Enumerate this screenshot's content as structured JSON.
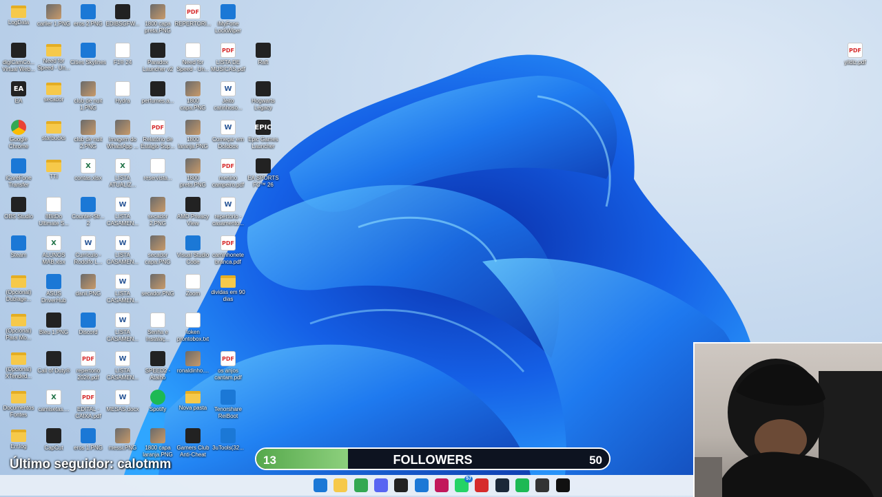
{
  "desktop": {
    "icons": [
      {
        "label": "LogData",
        "type": "folder",
        "glyph": ""
      },
      {
        "label": "carlier 1.PNG",
        "type": "img",
        "glyph": ""
      },
      {
        "label": "eros 2.PNG",
        "type": "blue",
        "glyph": ""
      },
      {
        "label": "EDIBSGFW...",
        "type": "app",
        "glyph": ""
      },
      {
        "label": "1800 capa preta.PNG",
        "type": "img",
        "glyph": ""
      },
      {
        "label": "REPERTORI...",
        "type": "pdf",
        "glyph": "PDF"
      },
      {
        "label": "iMyFone LockWiper",
        "type": "blue",
        "glyph": ""
      },
      {
        "label": "digiCamCo... Virtual Web...",
        "type": "app",
        "glyph": ""
      },
      {
        "label": "Need for Speed - Un...",
        "type": "folder",
        "glyph": ""
      },
      {
        "label": "Cities Skylines",
        "type": "blue",
        "glyph": ""
      },
      {
        "label": "F1® 24",
        "type": "txt",
        "glyph": ""
      },
      {
        "label": "Paradox Launcher v2",
        "type": "app",
        "glyph": ""
      },
      {
        "label": "Need for Speed - Un...",
        "type": "txt",
        "glyph": ""
      },
      {
        "label": "LISTA DE MUSICAS.pdf",
        "type": "pdf",
        "glyph": "PDF"
      },
      {
        "label": "Raft",
        "type": "app",
        "glyph": ""
      },
      {
        "label": "EA",
        "type": "app",
        "glyph": "EA"
      },
      {
        "label": "secador",
        "type": "folder",
        "glyph": ""
      },
      {
        "label": "club de nuit 1.PNG",
        "type": "img",
        "glyph": ""
      },
      {
        "label": "Hydra",
        "type": "txt",
        "glyph": ""
      },
      {
        "label": "perfumes.a...",
        "type": "app",
        "glyph": ""
      },
      {
        "label": "1800 capa.PNG",
        "type": "img",
        "glyph": ""
      },
      {
        "label": "Jeito carinhoso...",
        "type": "doc",
        "glyph": "W"
      },
      {
        "label": "Hogwarts Legacy",
        "type": "app",
        "glyph": ""
      },
      {
        "label": "Google Chrome",
        "type": "chrome",
        "glyph": ""
      },
      {
        "label": "starbucks",
        "type": "folder",
        "glyph": ""
      },
      {
        "label": "club de nuit 2.PNG",
        "type": "img",
        "glyph": ""
      },
      {
        "label": "Imagem do WhatsApp ...",
        "type": "img",
        "glyph": ""
      },
      {
        "label": "Relatório de Estágio Sup...",
        "type": "pdf",
        "glyph": "PDF"
      },
      {
        "label": "1800 laranja.PNG",
        "type": "img",
        "glyph": ""
      },
      {
        "label": "Começar em Dolobox",
        "type": "doc",
        "glyph": "W"
      },
      {
        "label": "Epic Games Launcher",
        "type": "app",
        "glyph": "EPIC"
      },
      {
        "label": "iCareFone Transfer",
        "type": "blue",
        "glyph": ""
      },
      {
        "label": "TTI",
        "type": "folder",
        "glyph": ""
      },
      {
        "label": "contas.xlsx",
        "type": "xls",
        "glyph": "X"
      },
      {
        "label": "LISTA ATUALIZ...",
        "type": "xls",
        "glyph": "X"
      },
      {
        "label": "reservista...",
        "type": "txt",
        "glyph": ""
      },
      {
        "label": "1800 preto.PNG",
        "type": "img",
        "glyph": ""
      },
      {
        "label": "menino campeiro.pdf",
        "type": "pdf",
        "glyph": "PDF"
      },
      {
        "label": "EA SPORTS FC™ 26",
        "type": "app",
        "glyph": ""
      },
      {
        "label": "OBS Studio",
        "type": "app",
        "glyph": ""
      },
      {
        "label": "8BitDo Ultimate S...",
        "type": "txt",
        "glyph": ""
      },
      {
        "label": "Counter-Str... 2",
        "type": "blue",
        "glyph": ""
      },
      {
        "label": "LISTA CASAMEN...",
        "type": "doc",
        "glyph": "W"
      },
      {
        "label": "secador 2.PNG",
        "type": "img",
        "glyph": ""
      },
      {
        "label": "AMD Privacy View",
        "type": "app",
        "glyph": ""
      },
      {
        "label": "repertorio - casamento...",
        "type": "doc",
        "glyph": "W"
      },
      {
        "label": "Steam",
        "type": "blue",
        "glyph": ""
      },
      {
        "label": "ALUNOS MAB.xlsx",
        "type": "xls",
        "glyph": "X"
      },
      {
        "label": "Currículo - Rodolfo L...",
        "type": "doc",
        "glyph": "W"
      },
      {
        "label": "LISTA CASAMEN...",
        "type": "doc",
        "glyph": "W"
      },
      {
        "label": "secador capa.PNG",
        "type": "img",
        "glyph": ""
      },
      {
        "label": "Visual Studio Code",
        "type": "blue",
        "glyph": ""
      },
      {
        "label": "caminhonete branca.pdf",
        "type": "pdf",
        "glyph": "PDF"
      },
      {
        "label": "(Opcional) Dublage...",
        "type": "folder",
        "glyph": ""
      },
      {
        "label": "ASUS DriverHub",
        "type": "blue",
        "glyph": ""
      },
      {
        "label": "danii.PNG",
        "type": "img",
        "glyph": ""
      },
      {
        "label": "LISTA CASAMEN...",
        "type": "doc",
        "glyph": "W"
      },
      {
        "label": "secador.PNG",
        "type": "img",
        "glyph": ""
      },
      {
        "label": "Zoom",
        "type": "txt",
        "glyph": ""
      },
      {
        "label": "dividas em 90 dias",
        "type": "folder",
        "glyph": ""
      },
      {
        "label": "(Opcional) Para Mo...",
        "type": "folder",
        "glyph": ""
      },
      {
        "label": "Bleu 1.PNG",
        "type": "app",
        "glyph": ""
      },
      {
        "label": "Discord",
        "type": "blue",
        "glyph": ""
      },
      {
        "label": "LISTA CASAMEN...",
        "type": "doc",
        "glyph": "W"
      },
      {
        "label": "Senha e Instalaç...",
        "type": "txt",
        "glyph": ""
      },
      {
        "label": "token prontobox.txt",
        "type": "txt",
        "glyph": ""
      },
      {
        "label": "(Opcional) XTended...",
        "type": "folder",
        "glyph": ""
      },
      {
        "label": "Call of Duty®",
        "type": "app",
        "glyph": ""
      },
      {
        "label": "repertorio 2026.pdf",
        "type": "pdf",
        "glyph": "PDF"
      },
      {
        "label": "LISTA CASAMEN...",
        "type": "doc",
        "glyph": "W"
      },
      {
        "label": "SPEED2 - Atalho",
        "type": "app",
        "glyph": ""
      },
      {
        "label": "ronaldinho....",
        "type": "img",
        "glyph": ""
      },
      {
        "label": "os anjos cantam.pdf",
        "type": "pdf",
        "glyph": "PDF"
      },
      {
        "label": "Documentos Fontes",
        "type": "folder",
        "glyph": ""
      },
      {
        "label": "camisetas....",
        "type": "xls",
        "glyph": "X"
      },
      {
        "label": "EDITAL - CAIXA.pdf",
        "type": "pdf",
        "glyph": "PDF"
      },
      {
        "label": "MESAS.docx",
        "type": "doc",
        "glyph": "W"
      },
      {
        "label": "Spotify",
        "type": "green",
        "glyph": ""
      },
      {
        "label": "Nova pasta",
        "type": "folder",
        "glyph": ""
      },
      {
        "label": "Tenorshare ReiBoot",
        "type": "blue",
        "glyph": ""
      },
      {
        "label": "Err.log",
        "type": "folder",
        "glyph": ""
      },
      {
        "label": "CapCut",
        "type": "app",
        "glyph": ""
      },
      {
        "label": "eros 1.PNG",
        "type": "blue",
        "glyph": ""
      },
      {
        "label": "messi.PNG",
        "type": "img",
        "glyph": ""
      },
      {
        "label": "1800 capa laranja.PNG",
        "type": "img",
        "glyph": ""
      },
      {
        "label": "Gamers Club Anti-Cheat",
        "type": "app",
        "glyph": ""
      },
      {
        "label": "3uTools(32...",
        "type": "blue",
        "glyph": ""
      },
      {
        "label": "yildiz.pdf",
        "type": "pdf",
        "glyph": "PDF"
      }
    ]
  },
  "overlay": {
    "last_follower": "Último seguidor: calotmm",
    "followers_label": "FOLLOWERS",
    "followers_current": "13",
    "followers_goal": "50",
    "followers_progress": 0.26
  },
  "taskbar": {
    "items": [
      {
        "name": "start",
        "glyph": "",
        "color": "#1b78d6"
      },
      {
        "name": "file-explorer",
        "glyph": "",
        "color": "#f6c94a"
      },
      {
        "name": "chrome",
        "glyph": "",
        "color": "#34a853"
      },
      {
        "name": "discord",
        "glyph": "",
        "color": "#5865f2"
      },
      {
        "name": "call-of-duty",
        "glyph": "",
        "color": "#222222"
      },
      {
        "name": "counter-strike",
        "glyph": "",
        "color": "#1b78d6"
      },
      {
        "name": "snipping",
        "glyph": "",
        "color": "#c2185b"
      },
      {
        "name": "whatsapp",
        "glyph": "",
        "color": "#25d366",
        "badge": "57"
      },
      {
        "name": "amd",
        "glyph": "",
        "color": "#d62b2b"
      },
      {
        "name": "steam",
        "glyph": "",
        "color": "#1b2838"
      },
      {
        "name": "spotify",
        "glyph": "",
        "color": "#1db954"
      },
      {
        "name": "obs",
        "glyph": "",
        "color": "#333333"
      },
      {
        "name": "ea-fc",
        "glyph": "",
        "color": "#111111"
      }
    ]
  }
}
